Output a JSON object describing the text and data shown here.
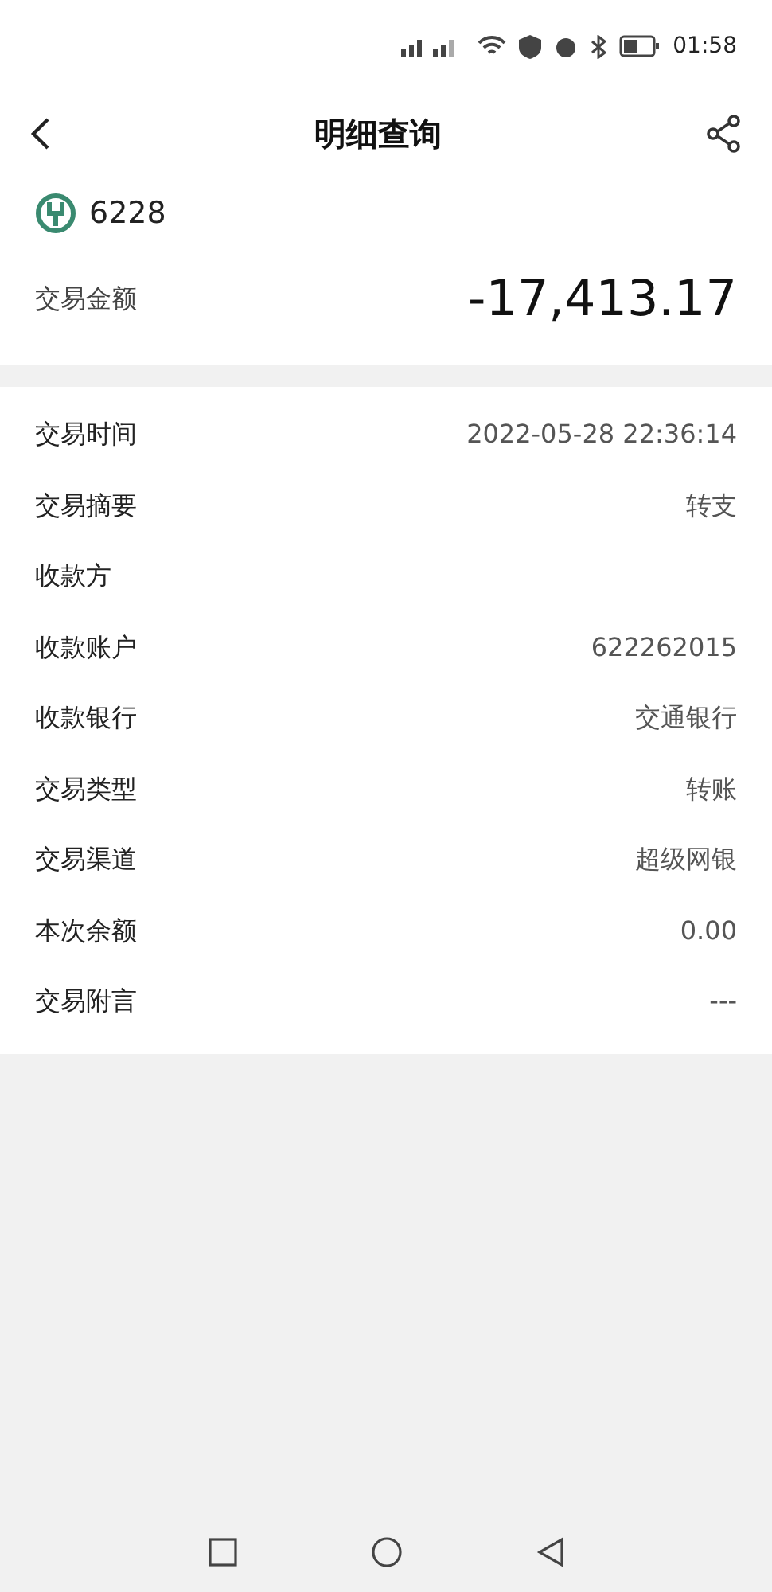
{
  "status_bar": {
    "time": "01:58"
  },
  "header": {
    "title": "明细查询"
  },
  "account": {
    "number": "6228"
  },
  "amount": {
    "label": "交易金额",
    "value": "-17,413.17"
  },
  "details": [
    {
      "label": "交易时间",
      "value": "2022-05-28 22:36:14"
    },
    {
      "label": "交易摘要",
      "value": "转支"
    },
    {
      "label": "收款方"
    },
    {
      "label": "收款账户",
      "value": "622262015"
    },
    {
      "label": "收款银行",
      "value": "交通银行"
    },
    {
      "label": "交易类型",
      "value": "转账"
    },
    {
      "label": "交易渠道",
      "value": "超级网银"
    },
    {
      "label": "本次余额",
      "value": "0.00"
    },
    {
      "label": "交易附言",
      "value": "---"
    }
  ]
}
